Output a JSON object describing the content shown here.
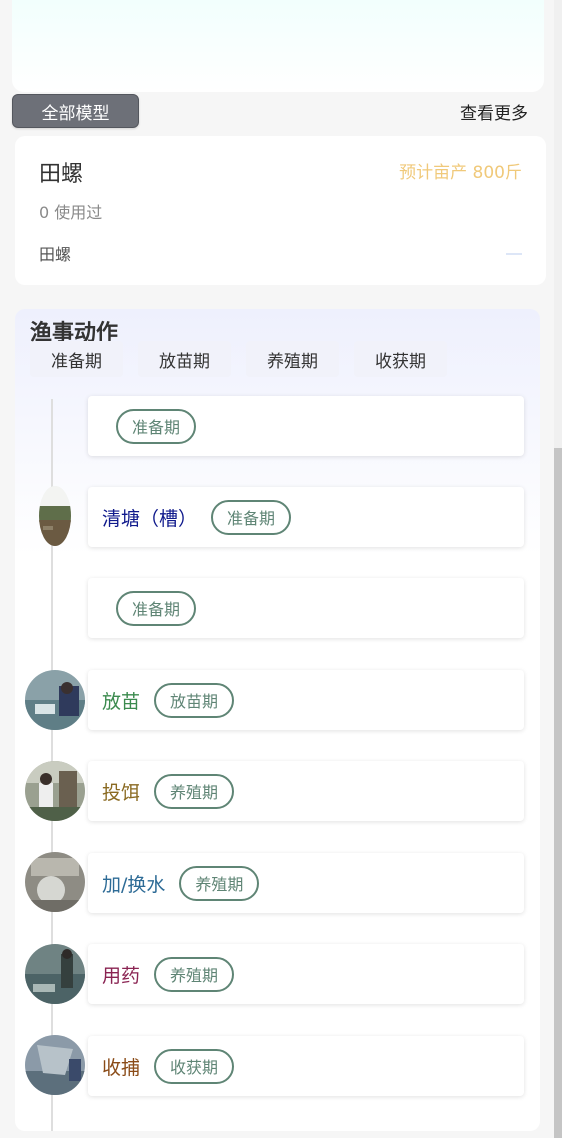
{
  "filter": {
    "all_models_label": "全部模型",
    "view_more_label": "查看更多"
  },
  "model": {
    "name": "田螺",
    "yield": "预计亩产 800斤",
    "usage": "0 使用过",
    "desc": "田螺"
  },
  "actions": {
    "title": "渔事动作",
    "tabs": [
      "准备期",
      "放苗期",
      "养殖期",
      "收获期"
    ],
    "items": [
      {
        "title": "",
        "phase": "准备期",
        "color": "#000080"
      },
      {
        "title": "清塘（槽）",
        "phase": "准备期",
        "color": "#101a8c"
      },
      {
        "title": "",
        "phase": "准备期",
        "color": "#000080"
      },
      {
        "title": "放苗",
        "phase": "放苗期",
        "color": "#3b8a4e"
      },
      {
        "title": "投饵",
        "phase": "养殖期",
        "color": "#8a6a22"
      },
      {
        "title": "加/换水",
        "phase": "养殖期",
        "color": "#2d6b96"
      },
      {
        "title": "用药",
        "phase": "养殖期",
        "color": "#8a2352"
      },
      {
        "title": "收捕",
        "phase": "收获期",
        "color": "#8a4b17"
      }
    ]
  }
}
